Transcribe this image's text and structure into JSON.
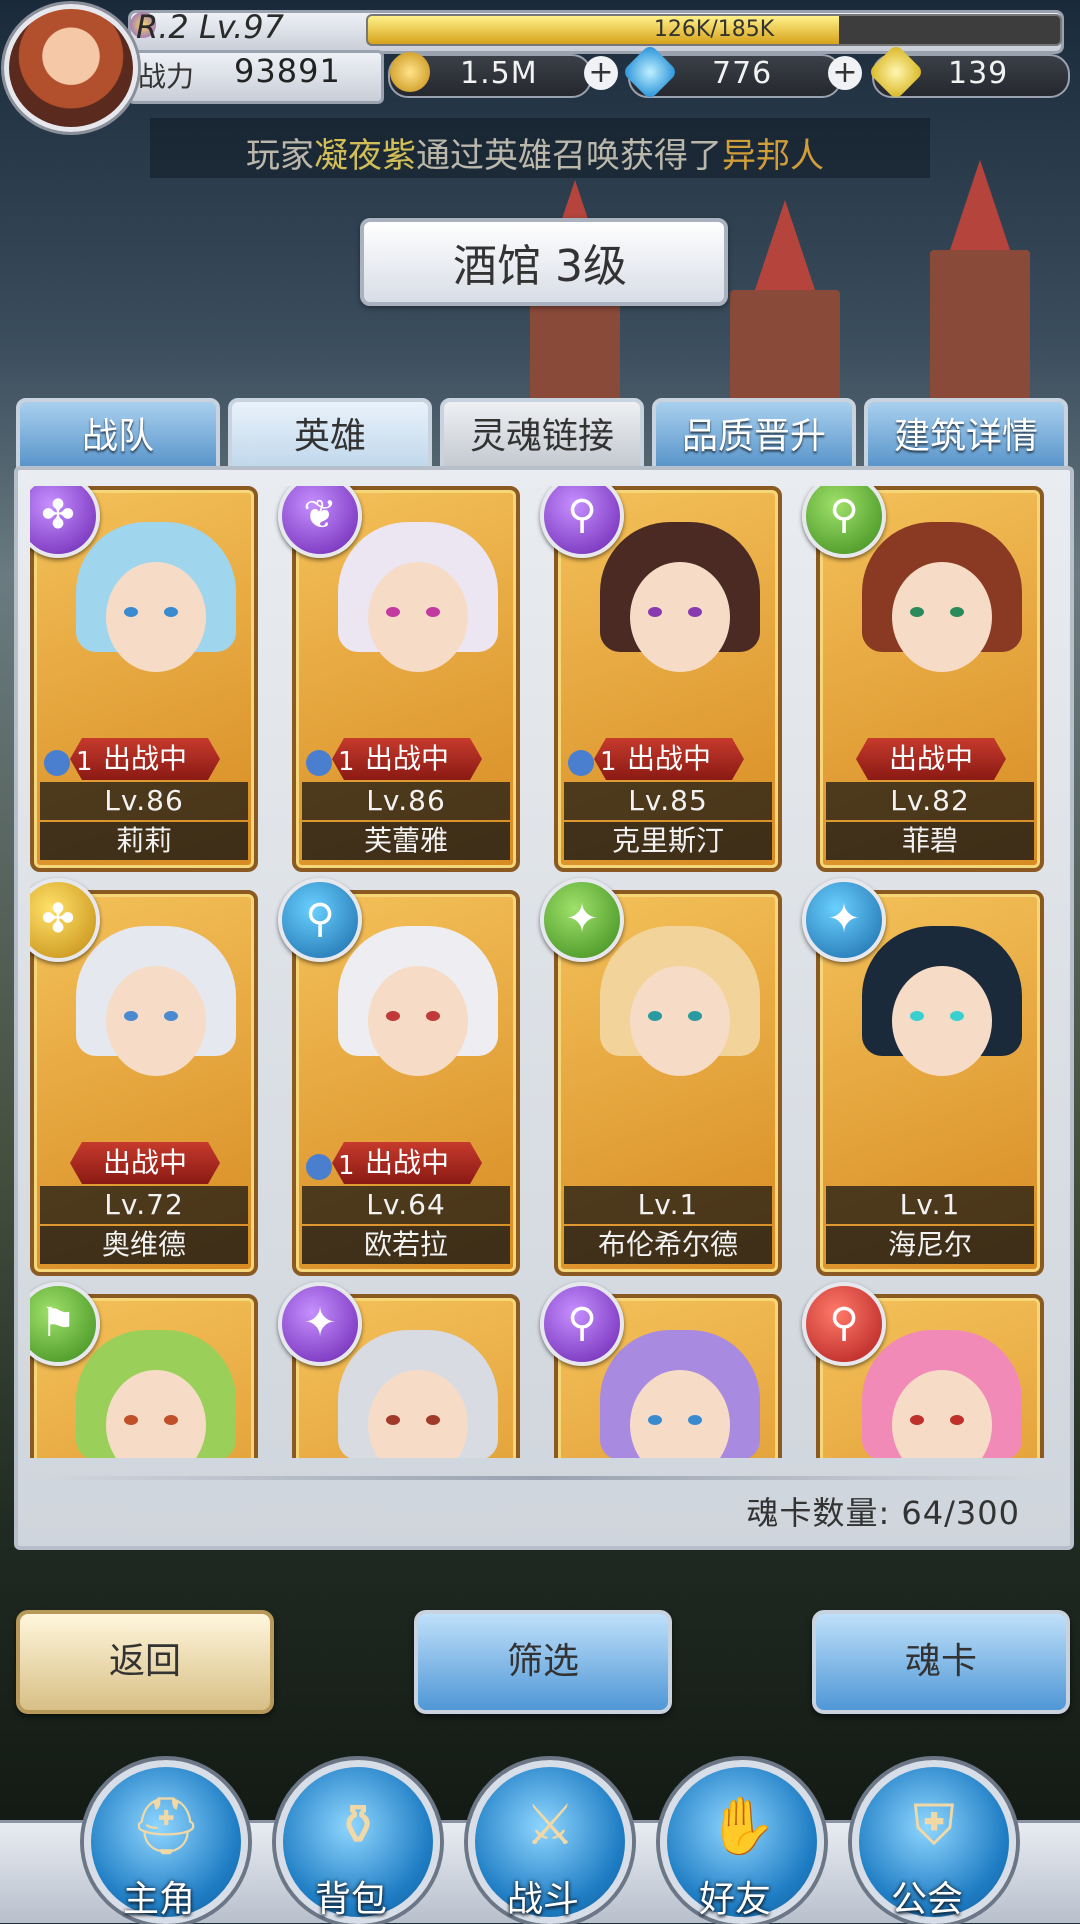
{
  "player": {
    "rank_level": "R.2 Lv.97",
    "exp_text": "126K/185K",
    "exp_fraction": 0.68,
    "power_label": "战力",
    "power_value": "93891"
  },
  "resources": [
    {
      "name": "gold",
      "value": "1.5M",
      "icon": "coin-icon",
      "color": "#f2c23a"
    },
    {
      "name": "diamond",
      "value": "776",
      "icon": "diamond-icon",
      "color": "#3ab7f2"
    },
    {
      "name": "gem",
      "value": "139",
      "icon": "yellow-gem-icon",
      "color": "#f4e06a"
    }
  ],
  "marquee": {
    "prefix": "玩家",
    "player": "凝夜紫",
    "middle": "通过英雄召唤获得了",
    "hero": "异邦人"
  },
  "building_title": "酒馆 3级",
  "tabs": [
    {
      "label": "战队",
      "state": "normal"
    },
    {
      "label": "英雄",
      "state": "active"
    },
    {
      "label": "灵魂链接",
      "state": "grey"
    },
    {
      "label": "品质晋升",
      "state": "normal"
    },
    {
      "label": "建筑详情",
      "state": "normal"
    }
  ],
  "heroes": [
    {
      "name": "莉莉",
      "level": "Lv.86",
      "deploy": "出战中",
      "stack": "1",
      "class": "purple",
      "symbol": "✤",
      "hair": "#9fd6ee",
      "eyes": "#3a8ad0"
    },
    {
      "name": "芙蕾雅",
      "level": "Lv.86",
      "deploy": "出战中",
      "stack": "1",
      "class": "purple",
      "symbol": "❦",
      "hair": "#ece6f2",
      "eyes": "#c13aa0"
    },
    {
      "name": "克里斯汀",
      "level": "Lv.85",
      "deploy": "出战中",
      "stack": "1",
      "class": "purple",
      "symbol": "⚲",
      "hair": "#4a2a22",
      "eyes": "#8a3ab0"
    },
    {
      "name": "菲碧",
      "level": "Lv.82",
      "deploy": "出战中",
      "stack": "",
      "class": "green",
      "symbol": "⚲",
      "hair": "#8a3a22",
      "eyes": "#2a8a5a"
    },
    {
      "name": "奥维德",
      "level": "Lv.72",
      "deploy": "出战中",
      "stack": "",
      "class": "yellow",
      "symbol": "✤",
      "hair": "#e6e8f0",
      "eyes": "#4a8ad0"
    },
    {
      "name": "欧若拉",
      "level": "Lv.64",
      "deploy": "出战中",
      "stack": "1",
      "class": "blue",
      "symbol": "⚲",
      "hair": "#eeeef2",
      "eyes": "#c13a3a"
    },
    {
      "name": "布伦希尔德",
      "level": "Lv.1",
      "deploy": "",
      "stack": "",
      "class": "green",
      "symbol": "✦",
      "hair": "#f2d49a",
      "eyes": "#2a9aa0"
    },
    {
      "name": "海尼尔",
      "level": "Lv.1",
      "deploy": "",
      "stack": "",
      "class": "blue",
      "symbol": "✦",
      "hair": "#1a2a3a",
      "eyes": "#3ad0d0"
    },
    {
      "name": "",
      "level": "",
      "deploy": "",
      "stack": "",
      "class": "green",
      "symbol": "⚑",
      "hair": "#9ad05a",
      "eyes": "#c0502a"
    },
    {
      "name": "",
      "level": "",
      "deploy": "",
      "stack": "",
      "class": "purple",
      "symbol": "✦",
      "hair": "#d8dbe2",
      "eyes": "#a03a2a"
    },
    {
      "name": "",
      "level": "",
      "deploy": "",
      "stack": "",
      "class": "purple",
      "symbol": "⚲",
      "hair": "#a88ae0",
      "eyes": "#3a8ad0"
    },
    {
      "name": "",
      "level": "",
      "deploy": "",
      "stack": "",
      "class": "red",
      "symbol": "⚲",
      "hair": "#f28ab8",
      "eyes": "#c0302a"
    }
  ],
  "soul_card_count": "魂卡数量: 64/300",
  "buttons": {
    "back": "返回",
    "filter": "筛选",
    "soul_card": "魂卡"
  },
  "nav": [
    {
      "label": "主角",
      "icon": "helmet-icon"
    },
    {
      "label": "背包",
      "icon": "backpack-icon"
    },
    {
      "label": "战斗",
      "icon": "crossed-swords-icon"
    },
    {
      "label": "好友",
      "icon": "handshake-icon"
    },
    {
      "label": "公会",
      "icon": "guild-crest-icon"
    }
  ]
}
